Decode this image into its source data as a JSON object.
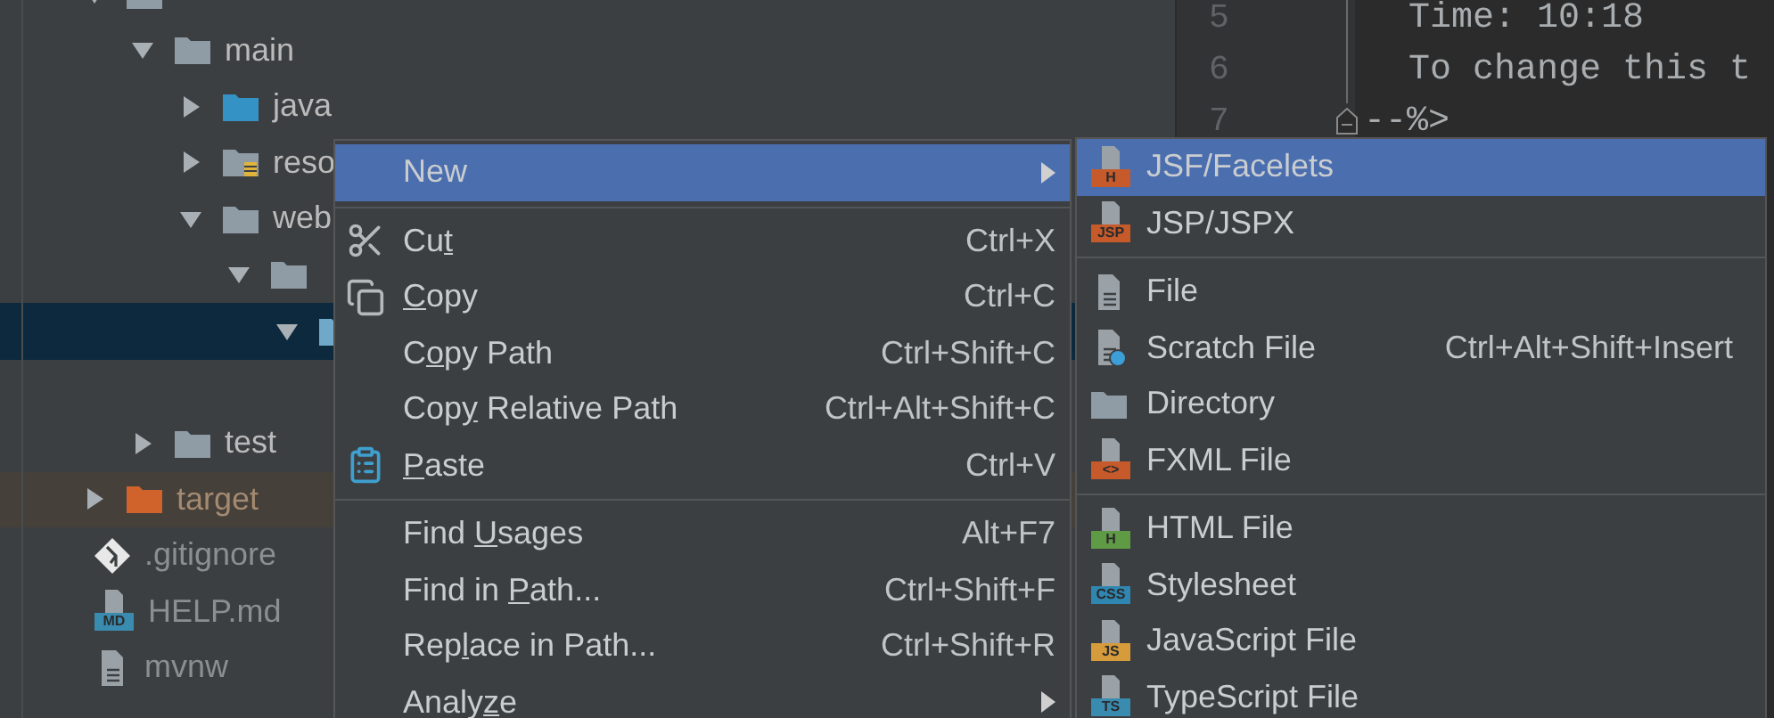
{
  "tree": [
    {
      "expanded": true,
      "kind": "folder",
      "children": [
        {
          "label": "main",
          "expanded": true,
          "kind": "folder",
          "children": [
            {
              "label": "java",
              "expanded": false,
              "kind": "source-folder"
            },
            {
              "label": "reso",
              "expanded": false,
              "kind": "resources-folder"
            },
            {
              "label": "web",
              "expanded": true,
              "kind": "folder",
              "children": [
                {
                  "expanded": true,
                  "kind": "folder",
                  "children": [
                    {
                      "expanded": true,
                      "kind": "web-folder",
                      "selected": true
                    }
                  ]
                }
              ]
            }
          ]
        },
        {
          "empty": true
        },
        {
          "label": "test",
          "expanded": false,
          "kind": "folder"
        }
      ]
    },
    {
      "label": "target",
      "expanded": false,
      "kind": "excluded-folder",
      "excluded": true
    },
    {
      "label": ".gitignore",
      "kind": "git",
      "ignored": true
    },
    {
      "label": "HELP.md",
      "kind": "markdown",
      "badge": "MD",
      "ignored": true
    },
    {
      "label": "mvnw",
      "kind": "text",
      "ignored": true
    }
  ],
  "editor": {
    "lines": [
      {
        "number": "5",
        "text": "Time: 10:18"
      },
      {
        "number": "6",
        "text": "To change this t"
      },
      {
        "number": "7",
        "text": "--%>",
        "fold": true
      }
    ]
  },
  "context_menu": {
    "groups": [
      {
        "items": [
          {
            "label": "New",
            "selected": true,
            "submenu": true
          }
        ]
      },
      {
        "items": [
          {
            "label": "Cu",
            "mnemonic": "t",
            "kind": "scissors",
            "shortcut": "Ctrl+X",
            "selected": false
          },
          {
            "mnemonic": "C",
            "rest": "opy",
            "kind": "copy",
            "shortcut": "Ctrl+C",
            "selected": false
          },
          {
            "label": "C",
            "mnemonic": "o",
            "rest": "py Path",
            "shortcut": "Ctrl+Shift+C",
            "selected": false
          },
          {
            "label": "Cop",
            "mnemonic": "y",
            "rest": " Relative Path",
            "shortcut": "Ctrl+Alt+Shift+C",
            "selected": false
          },
          {
            "mnemonic": "P",
            "rest": "aste",
            "kind": "paste",
            "shortcut": "Ctrl+V",
            "selected": false
          }
        ]
      },
      {
        "items": [
          {
            "label": "Find ",
            "mnemonic": "U",
            "rest": "sages",
            "shortcut": "Alt+F7",
            "selected": false
          },
          {
            "label": "Find in ",
            "mnemonic": "P",
            "rest": "ath...",
            "shortcut": "Ctrl+Shift+F",
            "selected": false
          },
          {
            "label": "Rep",
            "mnemonic": "l",
            "rest": "ace in Path...",
            "shortcut": "Ctrl+Shift+R",
            "selected": false
          },
          {
            "label": "Analy",
            "mnemonic": "z",
            "rest": "e",
            "submenu": true,
            "selected": false
          }
        ]
      }
    ]
  },
  "submenu": {
    "groups": [
      {
        "items": [
          {
            "label": "JSF/Facelets",
            "kind": "badge",
            "badge": "H",
            "color": "#c75a2b",
            "selected": true
          },
          {
            "label": "JSP/JSPX",
            "kind": "badge",
            "badge": "JSP",
            "color": "#c75a2b",
            "selected": false
          }
        ]
      },
      {
        "items": [
          {
            "label": "File",
            "kind": "file",
            "selected": false
          },
          {
            "label": "Scratch File",
            "kind": "scratch",
            "shortcut": "Ctrl+Alt+Shift+Insert",
            "selected": false
          },
          {
            "label": "Directory",
            "kind": "folder",
            "selected": false
          },
          {
            "label": "FXML File",
            "kind": "badge",
            "badge": "<>",
            "color": "#c75a2b",
            "selected": false
          }
        ]
      },
      {
        "items": [
          {
            "label": "HTML File",
            "kind": "badge",
            "badge": "H",
            "color": "#5f9b45",
            "selected": false
          },
          {
            "label": "Stylesheet",
            "kind": "badge",
            "badge": "CSS",
            "color": "#2f86b1",
            "selected": false
          },
          {
            "label": "JavaScript File",
            "kind": "badge",
            "badge": "JS",
            "color": "#d69b3a",
            "selected": false
          },
          {
            "label": "TypeScript File",
            "kind": "badge",
            "badge": "TS",
            "color": "#3a8bb0",
            "selected": false
          }
        ]
      }
    ]
  }
}
